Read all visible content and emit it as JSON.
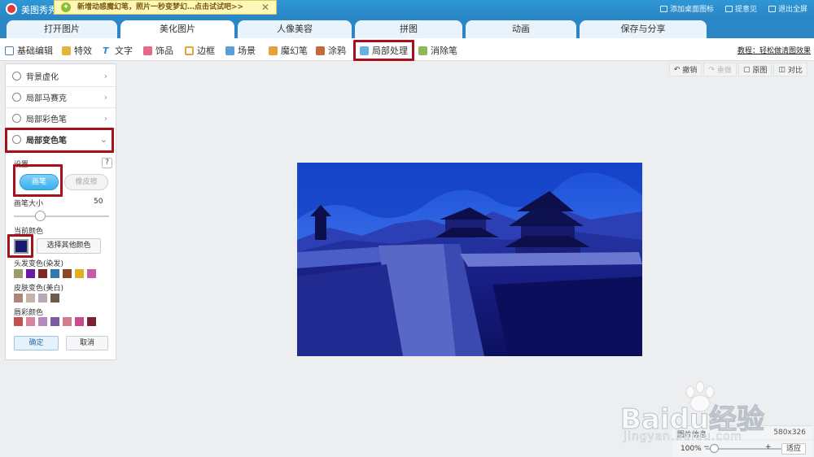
{
  "titlebar": {
    "app_title": "美图秀秀",
    "promo_text": "新增动感魔幻笔，照片一秒变梦幻…点击试试吧>>",
    "promo_close": "✕",
    "right_items": [
      "添加桌面图标",
      "提意见",
      "退出全屏"
    ]
  },
  "tabs": [
    "打开图片",
    "美化图片",
    "人像美容",
    "拼图",
    "动画",
    "保存与分享"
  ],
  "toolbar": {
    "items": [
      "基础编辑",
      "特效",
      "文字",
      "饰品",
      "边框",
      "场景",
      "魔幻笔",
      "涂鸦",
      "局部处理",
      "消除笔"
    ],
    "tutorial": "教程：轻松做清图效果"
  },
  "panel": {
    "accordion": [
      "背景虚化",
      "局部马赛克",
      "局部彩色笔",
      "局部变色笔"
    ],
    "settings_label": "设置",
    "help": "?",
    "brush_label": "画笔",
    "eraser_label": "橡皮擦",
    "brush_size_label": "画笔大小",
    "brush_size_value": "50",
    "brush_size_level": 0.27,
    "current_color_label": "当前颜色",
    "current_color": "#141a6e",
    "pick_other_color": "选择其他颜色",
    "hair_label": "头发变色(染发)",
    "hair_colors": [
      "#9b9a6a",
      "#6c1aa3",
      "#7e2a24",
      "#2f79b0",
      "#8a4a28",
      "#e0b11c",
      "#c75aa8"
    ],
    "skin_label": "皮肤变色(美白)",
    "skin_colors": [
      "#a9857a",
      "#c6b3a8",
      "#b7a9b7",
      "#6e5a4a"
    ],
    "lip_label": "唇彩颜色",
    "lip_colors": [
      "#c2504f",
      "#d9839d",
      "#b58ac1",
      "#7d5aa5",
      "#d17c8f",
      "#c94c8f",
      "#7a2232"
    ],
    "ok": "确定",
    "cancel": "取消"
  },
  "right_tools": [
    "撤销",
    "重做",
    "原图",
    "对比"
  ],
  "status": {
    "image_info_label": "图片信息",
    "image_size": "580x326",
    "zoom": "100%",
    "zoom_level": 0.1,
    "minus": "−",
    "plus": "+",
    "fit": "适应"
  },
  "watermark": {
    "brand": "Baidu经验",
    "url": "jingyan.baidu.com"
  }
}
